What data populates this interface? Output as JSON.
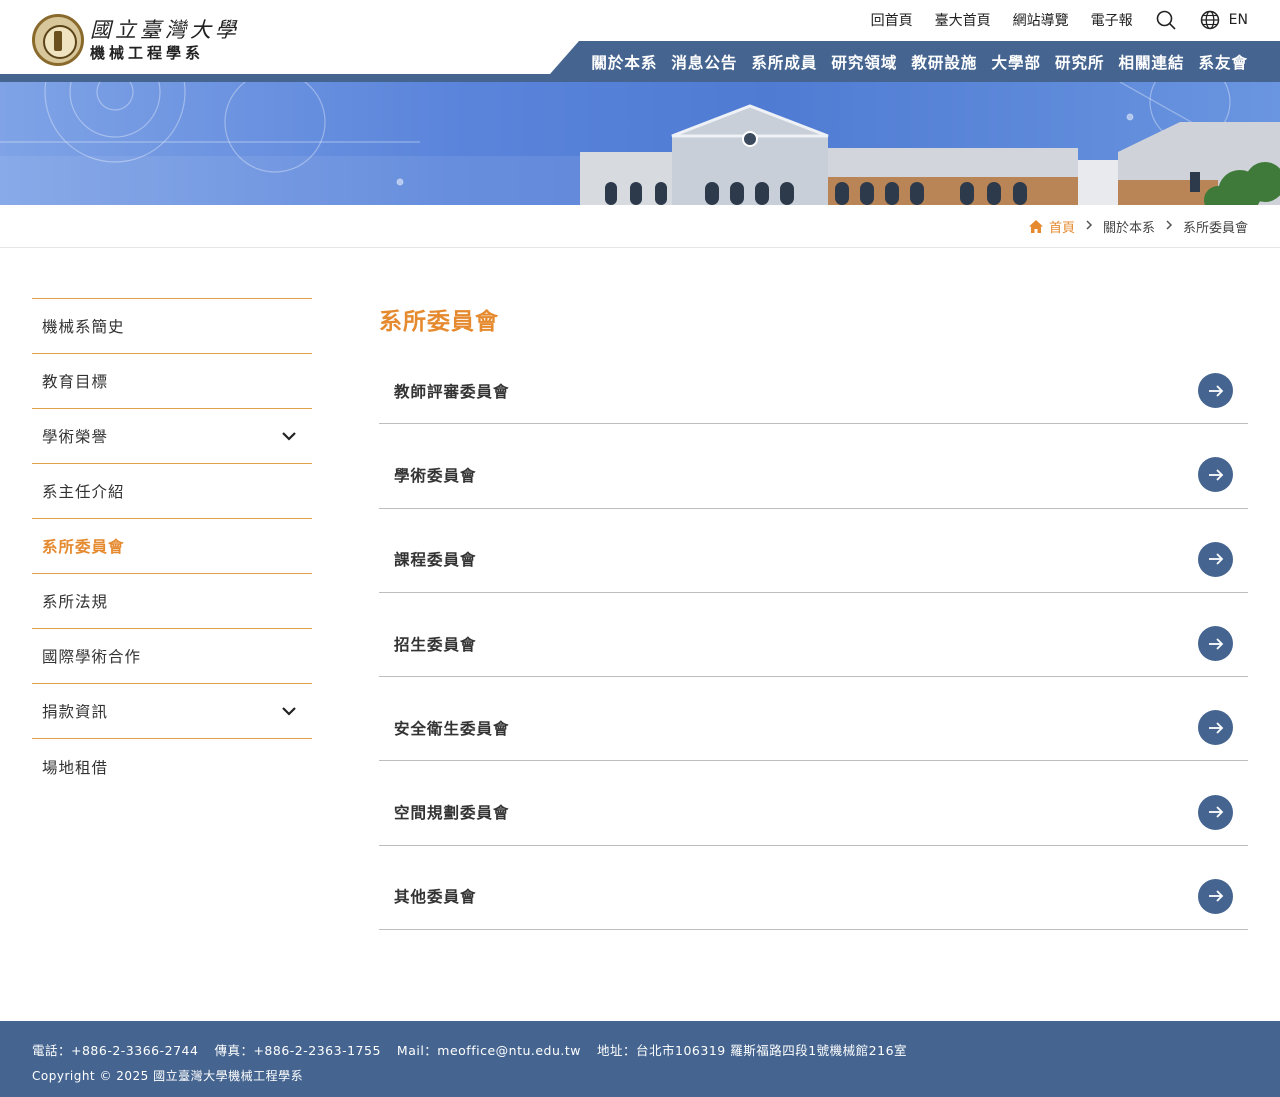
{
  "header": {
    "logo_line1": "國立臺灣大學",
    "logo_line2": "機械工程學系",
    "util_links": [
      "回首頁",
      "臺大首頁",
      "網站導覽",
      "電子報"
    ],
    "lang_label": "EN"
  },
  "main_nav": [
    "關於本系",
    "消息公告",
    "系所成員",
    "研究領域",
    "教研設施",
    "大學部",
    "研究所",
    "相關連結",
    "系友會"
  ],
  "breadcrumb": {
    "home": "首頁",
    "level1": "關於本系",
    "current": "系所委員會"
  },
  "sidebar": {
    "items": [
      {
        "label": "機械系簡史",
        "expandable": false,
        "active": false
      },
      {
        "label": "教育目標",
        "expandable": false,
        "active": false
      },
      {
        "label": "學術榮譽",
        "expandable": true,
        "active": false
      },
      {
        "label": "系主任介紹",
        "expandable": false,
        "active": false
      },
      {
        "label": "系所委員會",
        "expandable": false,
        "active": true
      },
      {
        "label": "系所法規",
        "expandable": false,
        "active": false
      },
      {
        "label": "國際學術合作",
        "expandable": false,
        "active": false
      },
      {
        "label": "捐款資訊",
        "expandable": true,
        "active": false
      },
      {
        "label": "場地租借",
        "expandable": false,
        "active": false
      }
    ]
  },
  "main": {
    "title": "系所委員會",
    "committees": [
      "教師評審委員會",
      "學術委員會",
      "課程委員會",
      "招生委員會",
      "安全衛生委員會",
      "空間規劃委員會",
      "其他委員會"
    ]
  },
  "footer": {
    "phone": "電話：+886-2-3366-2744",
    "fax": "傳真：+886-2-2363-1755",
    "mail": "Mail：meoffice@ntu.edu.tw",
    "address": "地址：台北市106319 羅斯福路四段1號機械館216室",
    "copyright": "Copyright © 2025 國立臺灣大學機械工程學系"
  },
  "colors": {
    "accent": "#e58a2f",
    "nav_blue": "#456590",
    "border_orange": "#e3a04a"
  }
}
